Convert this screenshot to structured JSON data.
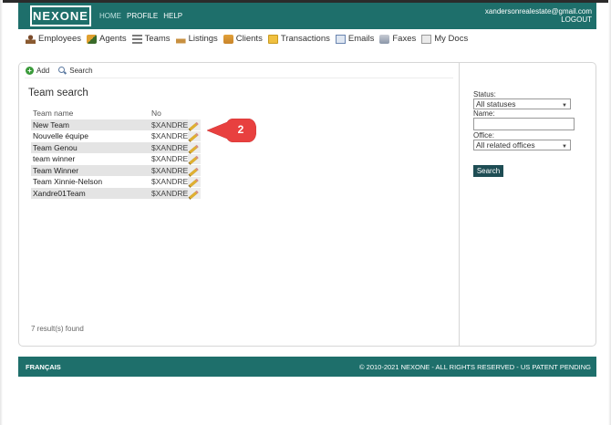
{
  "header": {
    "logo": "NEXONE",
    "nav": [
      "HOME",
      "PROFILE",
      "HELP"
    ],
    "email": "xandersonrealestate@gmail.com",
    "logout": "LOGOUT",
    "color": "#1e6f6b"
  },
  "mainnav": {
    "items": [
      {
        "label": "Employees",
        "icon": "employees-icon"
      },
      {
        "label": "Agents",
        "icon": "agents-icon"
      },
      {
        "label": "Teams",
        "icon": "teams-icon"
      },
      {
        "label": "Listings",
        "icon": "listings-icon"
      },
      {
        "label": "Clients",
        "icon": "clients-icon"
      },
      {
        "label": "Transactions",
        "icon": "transactions-folder-icon"
      },
      {
        "label": "Emails",
        "icon": "emails-icon"
      },
      {
        "label": "Faxes",
        "icon": "fax-icon"
      },
      {
        "label": "My Docs",
        "icon": "docs-icon"
      }
    ]
  },
  "toolbar": {
    "add": "Add",
    "search": "Search"
  },
  "main": {
    "title": "Team search",
    "columns": [
      "Team name",
      "No"
    ],
    "rows": [
      {
        "name": "New Team",
        "no": "$XANDRE"
      },
      {
        "name": "Nouvelle équipe",
        "no": "$XANDRE"
      },
      {
        "name": "Team Genou",
        "no": "$XANDRE"
      },
      {
        "name": "team winner",
        "no": "$XANDRE"
      },
      {
        "name": "Team Winner",
        "no": "$XANDRE"
      },
      {
        "name": "Team Xinnie-Nelson",
        "no": "$XANDRE"
      },
      {
        "name": "Xandre01Team",
        "no": "$XANDRE"
      }
    ],
    "results": "7 result(s) found"
  },
  "callout": {
    "number": "2",
    "color": "#e8403f"
  },
  "side": {
    "status_label": "Status:",
    "status_value": "All statuses",
    "name_label": "Name:",
    "office_label": "Office:",
    "office_value": "All related offices",
    "search_button": "Search"
  },
  "footer": {
    "language": "FRANÇAIS",
    "copyright": "© 2010-2021 NEXONE - ALL RIGHTS RESERVED - US PATENT PENDING"
  }
}
